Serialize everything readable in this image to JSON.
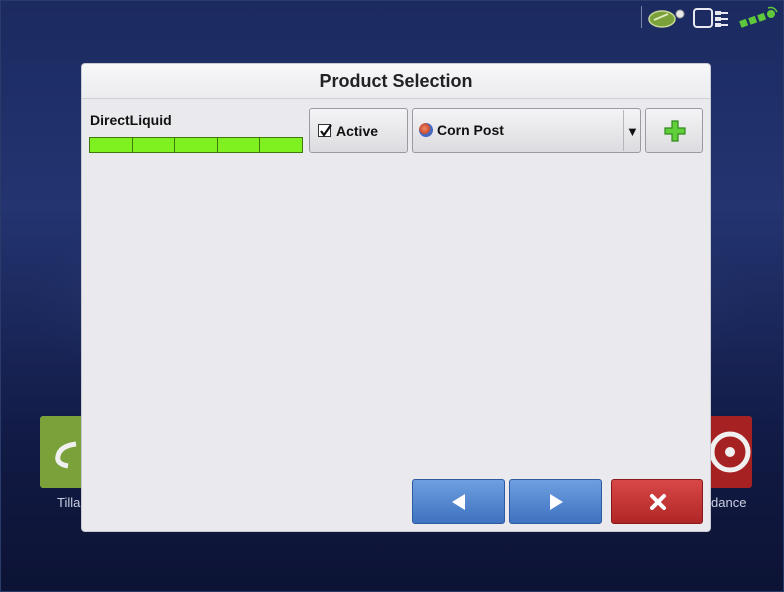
{
  "dialog": {
    "title": "Product Selection",
    "implement_name": "DirectLiquid",
    "section_count": 5,
    "active_label": "Active",
    "active_checked": true,
    "product_selected": "Corn Post",
    "add_icon": "plus-icon",
    "prev_icon": "arrow-left-icon",
    "next_icon": "arrow-right-icon",
    "cancel_icon": "close-icon"
  },
  "background": {
    "tile_left_label": "Tilla",
    "tile_right_label": "dance"
  },
  "status_bar": {
    "icons": [
      "planter-icon",
      "module-icon",
      "gps-signal-icon"
    ]
  },
  "colors": {
    "section_green": "#7ff020",
    "nav_blue": "#4f83cc",
    "cancel_red": "#c03333",
    "add_green": "#3fb52a"
  }
}
